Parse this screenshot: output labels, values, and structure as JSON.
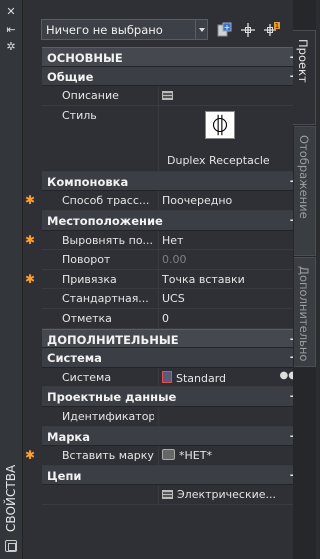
{
  "left_strip": {
    "close_icon": "close-icon",
    "autohide_icon": "autohide-icon",
    "settings_icon": "gear-icon",
    "title": "СВОЙСТВА"
  },
  "toolbar": {
    "selection_value": "Ничего не выбрано",
    "icons": [
      "quick-select-icon",
      "select-objects-icon",
      "toggle-pickadd-icon"
    ]
  },
  "grid": {
    "cat_basic": "ОСНОВНЫЕ",
    "sub_general": "Общие",
    "p_description": {
      "name": "Описание",
      "value": ""
    },
    "p_style": {
      "name": "Стиль",
      "value": "Duplex Receptacle"
    },
    "sub_layout": "Компоновка",
    "p_routing": {
      "name": "Способ трасс...",
      "value": "Поочередно"
    },
    "sub_location": "Местоположение",
    "p_align": {
      "name": "Выровнять по...",
      "value": "Нет"
    },
    "p_rotation": {
      "name": "Поворот",
      "value": "0.00"
    },
    "p_anchor": {
      "name": "Привязка",
      "value": "Точка вставки"
    },
    "p_standard": {
      "name": "Стандартная...",
      "value": "UCS"
    },
    "p_elevation": {
      "name": "Отметка",
      "value": "0"
    },
    "cat_additional": "ДОПОЛНИТЕЛЬНЫЕ",
    "sub_system": "Система",
    "p_system": {
      "name": "Система",
      "value": "Standard"
    },
    "sub_project": "Проектные данные",
    "p_identifier": {
      "name": "Идентификатор",
      "value": ""
    },
    "sub_tag": "Марка",
    "p_insert_tag": {
      "name": "Вставить марку",
      "value": "*НЕТ*"
    },
    "sub_circuits": "Цепи",
    "p_circuits": {
      "name": "",
      "value": "Электрические..."
    },
    "collapse_symbol": "−"
  },
  "tabs": {
    "project": "Проект",
    "display": "Отображение",
    "extended": "Дополнительно"
  },
  "colors": {
    "modified_marker": "#ff9f2e",
    "panel_bg": "#2e3035",
    "category_bg": "#45484e"
  }
}
